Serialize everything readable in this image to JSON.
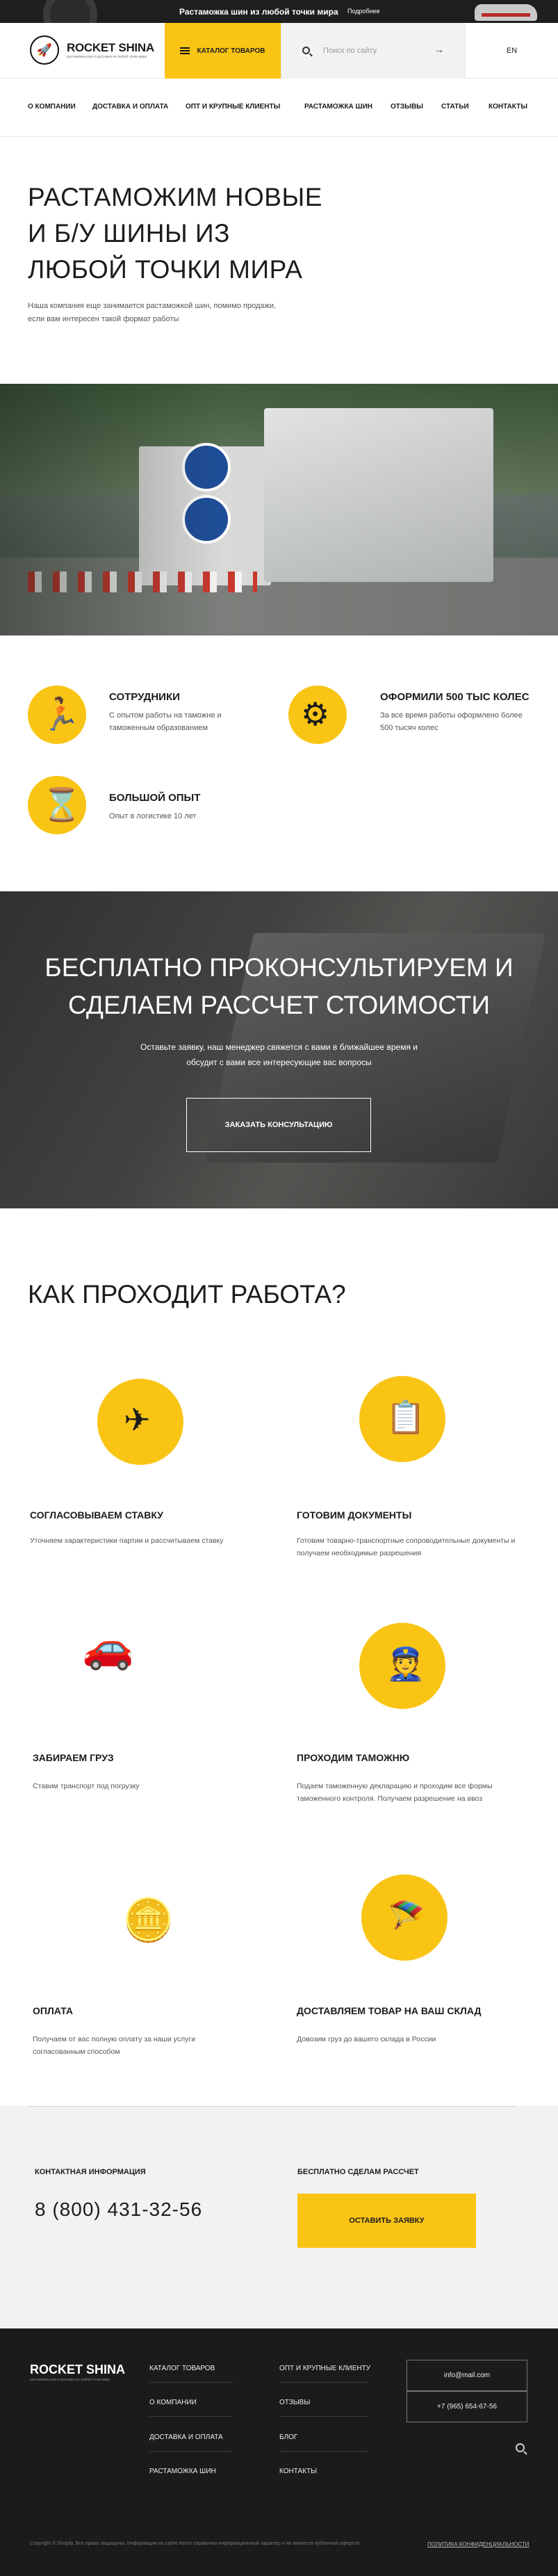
{
  "promo": {
    "text": "Растаможка шин из любой точки мира",
    "more": "Подробнее"
  },
  "header": {
    "logo_name": "ROCKET SHINA",
    "logo_sub": "растаможка шин и доставка из любой точки мира",
    "catalog_label": "Каталог товаров",
    "search_placeholder": "Поиск по сайту",
    "lang": "EN"
  },
  "nav": [
    "О компании",
    "Доставка и оплата",
    "Опт и крупные клиенты",
    "Растаможка шин",
    "Отзывы",
    "Статьи",
    "Контакты"
  ],
  "hero": {
    "title": "Растаможим новые и б/у шины из любой точки мира",
    "text": "Наша компания еще занимается растаможкой шин, помимо продажи, если вам интересен такой формат работы"
  },
  "features": [
    {
      "icon": "running-man-icon",
      "title": "Сотрудники",
      "text": "С опытом работы на таможне и таможенным образованием"
    },
    {
      "icon": "tire-stack-icon",
      "title": "Оформили 500 тыс колес",
      "text": "За все время работы оформлено более 500 тысяч колес"
    },
    {
      "icon": "hourglass-icon",
      "title": "Большой опыт",
      "text": "Опыт в логистике 10 лет"
    }
  ],
  "consult": {
    "title": "Бесплатно проконсультируем и сделаем рассчет стоимости",
    "text": "Оставьте заявку, наш менеджер свяжется с вами в ближайшее время и обсудит с вами все интересующие вас вопросы",
    "button": "Заказать консультацию"
  },
  "process": {
    "title": "Как проходит работа?",
    "steps": [
      {
        "icon": "plane-globe-icon",
        "title": "Согласовываем ставку",
        "text": "Уточняем характеристики партии и рассчитываем ставку"
      },
      {
        "icon": "clipboard-icon",
        "title": "Готовим документы",
        "text": "Готовим товарно-транспортные сопроводительные документы и получаем необходимые разрешения"
      },
      {
        "icon": "car-boxes-icon",
        "title": "Забираем груз",
        "text": "Ставим транспорт под погрузку"
      },
      {
        "icon": "customs-officers-icon",
        "title": "Проходим таможню",
        "text": "Подаем таможенную декларацию и проходим все формы таможенного контроля. Получаем разрешение на ввоз"
      },
      {
        "icon": "money-plant-icon",
        "title": "Оплата",
        "text": "Получаем от вас полную оплату за наши услуги согласованным способом"
      },
      {
        "icon": "parachute-boxes-icon",
        "title": "Доставляем товар на ваш склад",
        "text": "Довозим груз до вашего склада в России"
      }
    ]
  },
  "contact": {
    "label": "Контактная информация",
    "phone": "8 (800) 431-32-56",
    "calc_label": "Бесплатно сделам рассчет",
    "button": "Оставить заявку"
  },
  "footer": {
    "logo_name": "ROCKET SHINA",
    "logo_sub": "растаможка шин и доставка из любой точки мира",
    "col1": [
      "Каталог товаров",
      "О компании",
      "Доставка и оплата",
      "Растаможка шин"
    ],
    "col2": [
      "Опт и крупные клиенту",
      "Отзывы",
      "Блог",
      "Контакты"
    ],
    "email": "info@mail.com",
    "phone": "+7 (965) 654-67-56",
    "copyright": "Copyright © Shopify. Все права защищены. Информация на сайте носит справочно-информационный характер и не является публичной офертой",
    "policy": "Политика конфиденциальности"
  },
  "colors": {
    "accent": "#f9c414",
    "dark": "#1b1b1b",
    "light_bg": "#f2f2f2"
  }
}
